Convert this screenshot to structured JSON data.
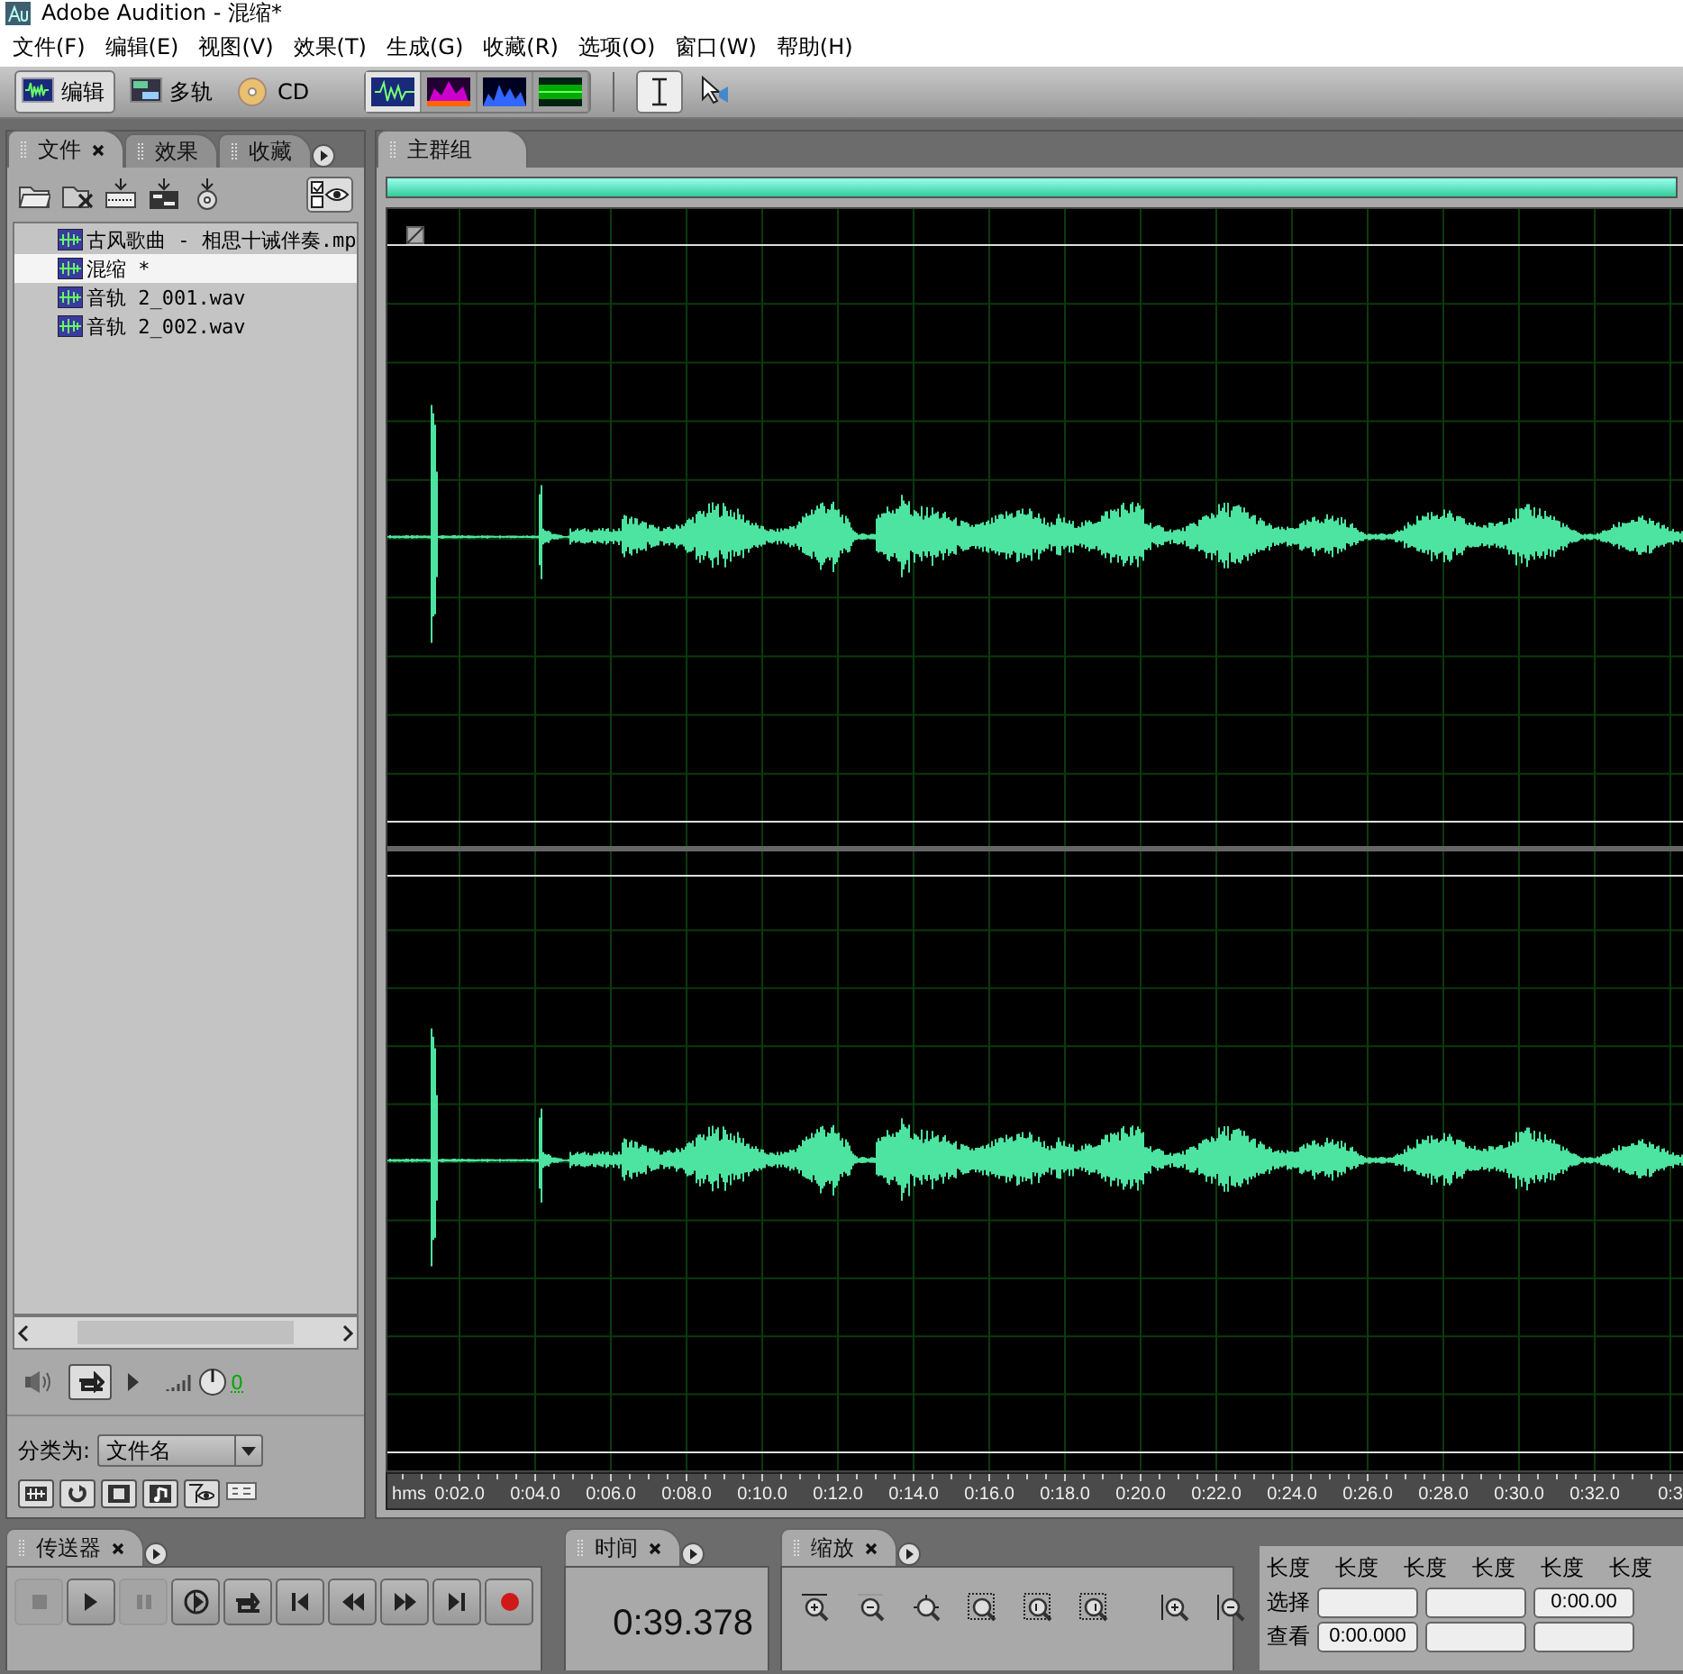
{
  "window": {
    "title": "Adobe Audition - 混缩*"
  },
  "menu": [
    "文件(F)",
    "编辑(E)",
    "视图(V)",
    "效果(T)",
    "生成(G)",
    "收藏(R)",
    "选项(O)",
    "窗口(W)",
    "帮助(H)"
  ],
  "workspaces": [
    {
      "kind": "edit",
      "label": "编辑",
      "selected": true
    },
    {
      "kind": "multitrack",
      "label": "多轨",
      "selected": false
    },
    {
      "kind": "cd",
      "label": "CD",
      "selected": false
    }
  ],
  "views": [
    {
      "kind": "waveform",
      "selected": true
    },
    {
      "kind": "spectral",
      "selected": false
    },
    {
      "kind": "pan",
      "selected": false
    },
    {
      "kind": "phase",
      "selected": false
    }
  ],
  "tools": [
    {
      "kind": "ibeam",
      "selected": true
    },
    {
      "kind": "arrow",
      "selected": false
    }
  ],
  "left_tabs": [
    {
      "label": "文件",
      "selected": true
    },
    {
      "label": "效果",
      "selected": false
    },
    {
      "label": "收藏",
      "selected": false
    }
  ],
  "files": [
    {
      "name": "古风歌曲 - 相思十诫伴奏.mp",
      "selected": false
    },
    {
      "name": "混缩 *",
      "selected": true
    },
    {
      "name": "音轨 2_001.wav",
      "selected": false
    },
    {
      "name": "音轨 2_002.wav",
      "selected": false
    }
  ],
  "level_reading": "0",
  "sort": {
    "label": "分类为:",
    "value": "文件名"
  },
  "editor_tab": "主群组",
  "ruler": {
    "unit": "hms",
    "ticks": [
      "0:02.0",
      "0:04.0",
      "0:06.0",
      "0:08.0",
      "0:10.0",
      "0:12.0",
      "0:14.0",
      "0:16.0",
      "0:18.0",
      "0:20.0",
      "0:22.0",
      "0:24.0",
      "0:26.0",
      "0:28.0",
      "0:30.0",
      "0:32.0",
      "0:3"
    ]
  },
  "transport": {
    "title": "传送器",
    "buttons": [
      {
        "kind": "stop",
        "disabled": true
      },
      {
        "kind": "play",
        "disabled": false
      },
      {
        "kind": "pause",
        "disabled": true
      },
      {
        "kind": "play-from-cursor",
        "disabled": false
      },
      {
        "kind": "loop",
        "disabled": false
      },
      {
        "kind": "to-start",
        "disabled": false
      },
      {
        "kind": "rewind",
        "disabled": false
      },
      {
        "kind": "forward",
        "disabled": false
      },
      {
        "kind": "to-end",
        "disabled": false
      },
      {
        "kind": "record",
        "disabled": false
      }
    ]
  },
  "time": {
    "title": "时间",
    "value": "0:39.378"
  },
  "zoom": {
    "title": "缩放"
  },
  "selection": {
    "headers": [
      "长度",
      "长度",
      "长度",
      "长度",
      "长度",
      "长度"
    ],
    "rows": [
      {
        "label": "选择",
        "fields": [
          {
            "kind": "blank"
          },
          {
            "kind": "blank"
          },
          {
            "kind": "value",
            "text": "0:00.00"
          }
        ]
      },
      {
        "label": "查看",
        "fields": [
          {
            "kind": "value",
            "text": "0:00.000"
          },
          {
            "kind": "blank"
          },
          {
            "kind": "blank"
          }
        ]
      }
    ]
  }
}
